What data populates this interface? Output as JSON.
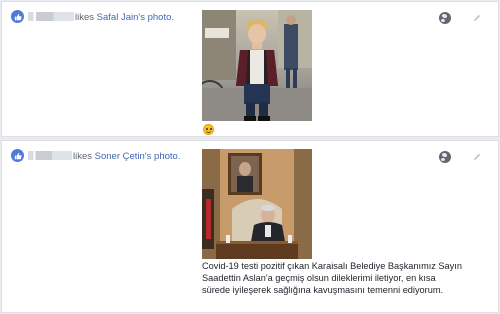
{
  "entries": [
    {
      "verb": "likes",
      "owner": "Safal Jain's",
      "object": "photo.",
      "has_emoji": true,
      "caption": ""
    },
    {
      "verb": "likes",
      "owner": "Soner Çetin's",
      "object": "photo.",
      "caption": "Covid-19 testi pozitif çıkan Karaisalı Belediye Başkanımız Sayın Saadettin Aslan'a geçmiş olsun dileklerimi iletiyor, en kısa sürede iyileşerek sağlığına kavuşmasını temenni ediyorum."
    }
  ],
  "icons": {
    "reaction": "thumbs-up-icon",
    "audience": "globe-icon",
    "edit": "pencil-icon",
    "emoji": "smiley-icon"
  },
  "colors": {
    "accent": "#4267b2",
    "like_badge": "#4c7bd9",
    "icon_gray": "#606770",
    "page_bg": "#e9ebee"
  }
}
